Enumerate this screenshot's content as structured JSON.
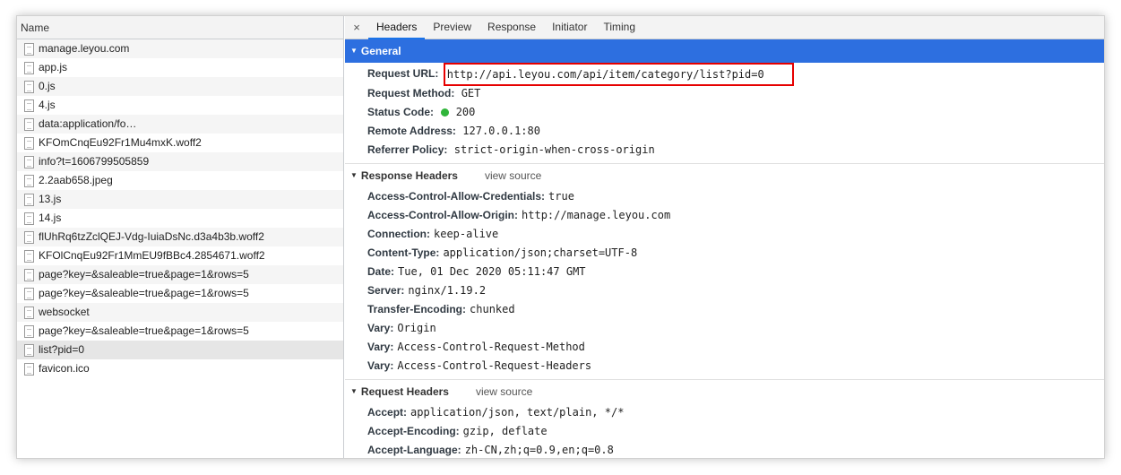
{
  "left": {
    "header": "Name",
    "requests": [
      "manage.leyou.com",
      "app.js",
      "0.js",
      "4.js",
      "data:application/fo…",
      "KFOmCnqEu92Fr1Mu4mxK.woff2",
      "info?t=1606799505859",
      "2.2aab658.jpeg",
      "13.js",
      "14.js",
      "flUhRq6tzZclQEJ-Vdg-IuiaDsNc.d3a4b3b.woff2",
      "KFOlCnqEu92Fr1MmEU9fBBc4.2854671.woff2",
      "page?key=&saleable=true&page=1&rows=5",
      "page?key=&saleable=true&page=1&rows=5",
      "websocket",
      "page?key=&saleable=true&page=1&rows=5",
      "list?pid=0",
      "favicon.ico"
    ],
    "selected_index": 16
  },
  "tabs": {
    "close": "×",
    "items": [
      "Headers",
      "Preview",
      "Response",
      "Initiator",
      "Timing"
    ],
    "active": "Headers"
  },
  "general": {
    "title": "General",
    "request_url_key": "Request URL:",
    "request_url": "http://api.leyou.com/api/item/category/list?pid=0",
    "request_method_key": "Request Method:",
    "request_method": "GET",
    "status_code_key": "Status Code:",
    "status_code": "200",
    "remote_address_key": "Remote Address:",
    "remote_address": "127.0.0.1:80",
    "referrer_policy_key": "Referrer Policy:",
    "referrer_policy": "strict-origin-when-cross-origin"
  },
  "response_headers": {
    "title": "Response Headers",
    "view_source": "view source",
    "items": [
      {
        "key": "Access-Control-Allow-Credentials:",
        "value": "true"
      },
      {
        "key": "Access-Control-Allow-Origin:",
        "value": "http://manage.leyou.com"
      },
      {
        "key": "Connection:",
        "value": "keep-alive"
      },
      {
        "key": "Content-Type:",
        "value": "application/json;charset=UTF-8"
      },
      {
        "key": "Date:",
        "value": "Tue, 01 Dec 2020 05:11:47 GMT"
      },
      {
        "key": "Server:",
        "value": "nginx/1.19.2"
      },
      {
        "key": "Transfer-Encoding:",
        "value": "chunked"
      },
      {
        "key": "Vary:",
        "value": "Origin"
      },
      {
        "key": "Vary:",
        "value": "Access-Control-Request-Method"
      },
      {
        "key": "Vary:",
        "value": "Access-Control-Request-Headers"
      }
    ]
  },
  "request_headers": {
    "title": "Request Headers",
    "view_source": "view source",
    "items": [
      {
        "key": "Accept:",
        "value": "application/json, text/plain, */*"
      },
      {
        "key": "Accept-Encoding:",
        "value": "gzip, deflate"
      },
      {
        "key": "Accept-Language:",
        "value": "zh-CN,zh;q=0.9,en;q=0.8"
      }
    ]
  },
  "colors": {
    "accent": "#2d6fe0",
    "highlight_box": "#e60000",
    "status_ok": "#30b53a"
  }
}
